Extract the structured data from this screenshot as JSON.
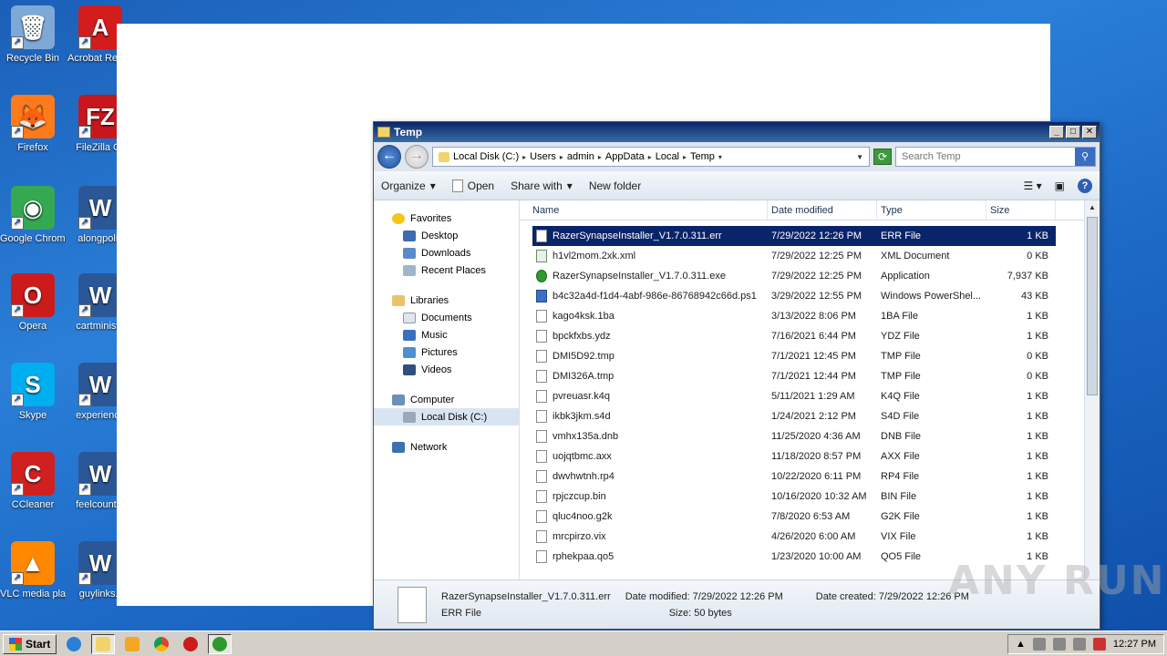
{
  "desktop": {
    "icons": [
      {
        "label": "Recycle Bin",
        "color": "#7ea9d6",
        "glyph": "🗑"
      },
      {
        "label": "Acrobat Reader D",
        "color": "#d31c1c",
        "glyph": "A"
      },
      {
        "label": "Firefox",
        "color": "#ff7a1a",
        "glyph": "🦊"
      },
      {
        "label": "FileZilla Cli",
        "color": "#c8171c",
        "glyph": "FZ"
      },
      {
        "label": "Google Chrome",
        "color": "#34a853",
        "glyph": "◉"
      },
      {
        "label": "alongpoliti",
        "color": "#2b5797",
        "glyph": "W"
      },
      {
        "label": "Opera",
        "color": "#cc1b1b",
        "glyph": "O"
      },
      {
        "label": "cartministe",
        "color": "#2b5797",
        "glyph": "W"
      },
      {
        "label": "Skype",
        "color": "#00aff0",
        "glyph": "S"
      },
      {
        "label": "experience",
        "color": "#2b5797",
        "glyph": "W"
      },
      {
        "label": "CCleaner",
        "color": "#d02020",
        "glyph": "C"
      },
      {
        "label": "feelcountry",
        "color": "#2b5797",
        "glyph": "W"
      },
      {
        "label": "VLC media player",
        "color": "#ff8800",
        "glyph": "▲"
      },
      {
        "label": "guylinks.r",
        "color": "#2b5797",
        "glyph": "W"
      }
    ]
  },
  "explorer": {
    "title": "Temp",
    "controls": {
      "minimize": "_",
      "maximize": "□",
      "close": "✕"
    },
    "breadcrumb": [
      "Local Disk (C:)",
      "Users",
      "admin",
      "AppData",
      "Local",
      "Temp"
    ],
    "search_placeholder": "Search Temp",
    "toolbar": {
      "organize": "Organize",
      "open": "Open",
      "share_with": "Share with",
      "new_folder": "New folder"
    },
    "nav": {
      "favorites": "Favorites",
      "desktop": "Desktop",
      "downloads": "Downloads",
      "recent_places": "Recent Places",
      "libraries": "Libraries",
      "documents": "Documents",
      "music": "Music",
      "pictures": "Pictures",
      "videos": "Videos",
      "computer": "Computer",
      "local_disk": "Local Disk (C:)",
      "network": "Network"
    },
    "columns": {
      "name": "Name",
      "date": "Date modified",
      "type": "Type",
      "size": "Size"
    },
    "files": [
      {
        "name": "RazerSynapseInstaller_V1.7.0.311.err",
        "date": "7/29/2022 12:26 PM",
        "type": "ERR File",
        "size": "1 KB",
        "icon": "file"
      },
      {
        "name": "h1vl2mom.2xk.xml",
        "date": "7/29/2022 12:25 PM",
        "type": "XML Document",
        "size": "0 KB",
        "icon": "xml"
      },
      {
        "name": "RazerSynapseInstaller_V1.7.0.311.exe",
        "date": "7/29/2022 12:25 PM",
        "type": "Application",
        "size": "7,937 KB",
        "icon": "exe"
      },
      {
        "name": "b4c32a4d-f1d4-4abf-986e-86768942c66d.ps1",
        "date": "3/29/2022 12:55 PM",
        "type": "Windows PowerShel...",
        "size": "43 KB",
        "icon": "ps"
      },
      {
        "name": "kago4ksk.1ba",
        "date": "3/13/2022 8:06 PM",
        "type": "1BA File",
        "size": "1 KB",
        "icon": "file"
      },
      {
        "name": "bpckfxbs.ydz",
        "date": "7/16/2021 6:44 PM",
        "type": "YDZ File",
        "size": "1 KB",
        "icon": "file"
      },
      {
        "name": "DMI5D92.tmp",
        "date": "7/1/2021 12:45 PM",
        "type": "TMP File",
        "size": "0 KB",
        "icon": "file"
      },
      {
        "name": "DMI326A.tmp",
        "date": "7/1/2021 12:44 PM",
        "type": "TMP File",
        "size": "0 KB",
        "icon": "file"
      },
      {
        "name": "pvreuasr.k4q",
        "date": "5/11/2021 1:29 AM",
        "type": "K4Q File",
        "size": "1 KB",
        "icon": "file"
      },
      {
        "name": "ikbk3jkm.s4d",
        "date": "1/24/2021 2:12 PM",
        "type": "S4D File",
        "size": "1 KB",
        "icon": "file"
      },
      {
        "name": "vmhx135a.dnb",
        "date": "11/25/2020 4:36 AM",
        "type": "DNB File",
        "size": "1 KB",
        "icon": "file"
      },
      {
        "name": "uojqtbmc.axx",
        "date": "11/18/2020 8:57 PM",
        "type": "AXX File",
        "size": "1 KB",
        "icon": "file"
      },
      {
        "name": "dwvhwtnh.rp4",
        "date": "10/22/2020 6:11 PM",
        "type": "RP4 File",
        "size": "1 KB",
        "icon": "file"
      },
      {
        "name": "rpjczcup.bin",
        "date": "10/16/2020 10:32 AM",
        "type": "BIN File",
        "size": "1 KB",
        "icon": "file"
      },
      {
        "name": "qluc4noo.g2k",
        "date": "7/8/2020 6:53 AM",
        "type": "G2K File",
        "size": "1 KB",
        "icon": "file"
      },
      {
        "name": "mrcpirzo.vix",
        "date": "4/26/2020 6:00 AM",
        "type": "VIX File",
        "size": "1 KB",
        "icon": "file"
      },
      {
        "name": "rphekpaa.qo5",
        "date": "1/23/2020 10:00 AM",
        "type": "QO5 File",
        "size": "1 KB",
        "icon": "file"
      }
    ],
    "details": {
      "filename": "RazerSynapseInstaller_V1.7.0.311.err",
      "filetype": "ERR File",
      "date_modified": "Date modified: 7/29/2022 12:26 PM",
      "size": "Size: 50 bytes",
      "date_created": "Date created: 7/29/2022 12:26 PM"
    }
  },
  "taskbar": {
    "start_label": "Start",
    "clock": "12:27 PM"
  },
  "watermark": "ANY RUN"
}
